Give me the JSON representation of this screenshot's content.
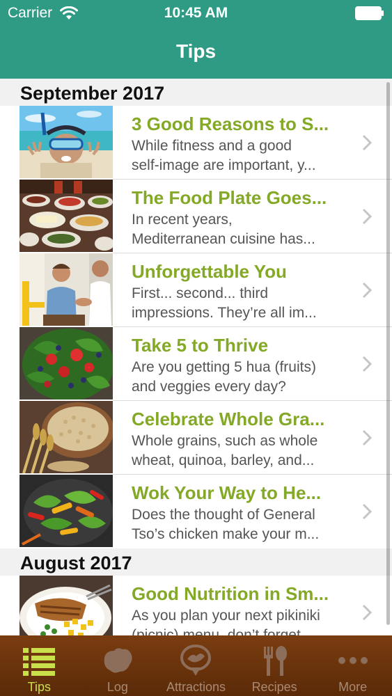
{
  "status_bar": {
    "carrier": "Carrier",
    "time": "10:45 AM"
  },
  "nav": {
    "title": "Tips"
  },
  "colors": {
    "header_teal": "#2f9b85",
    "title_green": "#84a927",
    "tabbar_brown": "#6b3410",
    "active_tab": "#c9e04b"
  },
  "sections": [
    {
      "header": "September 2017",
      "items": [
        {
          "title": "3 Good Reasons to S...",
          "desc_line1": "While fitness and a good",
          "desc_line2": "self-image are important, y...",
          "image": "snorkel-girl-photo"
        },
        {
          "title": "The Food Plate Goes...",
          "desc_line1": "In recent years,",
          "desc_line2": "Mediterranean cuisine has...",
          "image": "mediterranean-buffet-photo"
        },
        {
          "title": "Unforgettable You",
          "desc_line1": "First... second... third",
          "desc_line2": "impressions. They’re all im...",
          "image": "handshake-photo"
        },
        {
          "title": "Take 5 to Thrive",
          "desc_line1": "Are you getting 5 hua (fruits)",
          "desc_line2": "and veggies every day?",
          "image": "fruit-salad-photo"
        },
        {
          "title": "Celebrate Whole Gra...",
          "desc_line1": "Whole grains, such as whole",
          "desc_line2": "wheat, quinoa, barley, and...",
          "image": "whole-grains-photo"
        },
        {
          "title": "Wok Your Way to He...",
          "desc_line1": "Does the thought of General",
          "desc_line2": "Tso’s chicken make your m...",
          "image": "stir-fry-photo"
        }
      ]
    },
    {
      "header": "August 2017",
      "items": [
        {
          "title": "Good Nutrition in Sm...",
          "desc_line1": "As you plan your next pikiniki",
          "desc_line2": "(picnic) menu, don’t forget...",
          "image": "grilled-fish-plate-photo"
        }
      ]
    }
  ],
  "tabs": [
    {
      "label": "Tips",
      "icon": "list-icon",
      "active": true
    },
    {
      "label": "Log",
      "icon": "hawaii-map-icon",
      "active": false
    },
    {
      "label": "Attractions",
      "icon": "map-pin-icon",
      "active": false
    },
    {
      "label": "Recipes",
      "icon": "utensils-icon",
      "active": false
    },
    {
      "label": "More",
      "icon": "more-dots-icon",
      "active": false
    }
  ]
}
